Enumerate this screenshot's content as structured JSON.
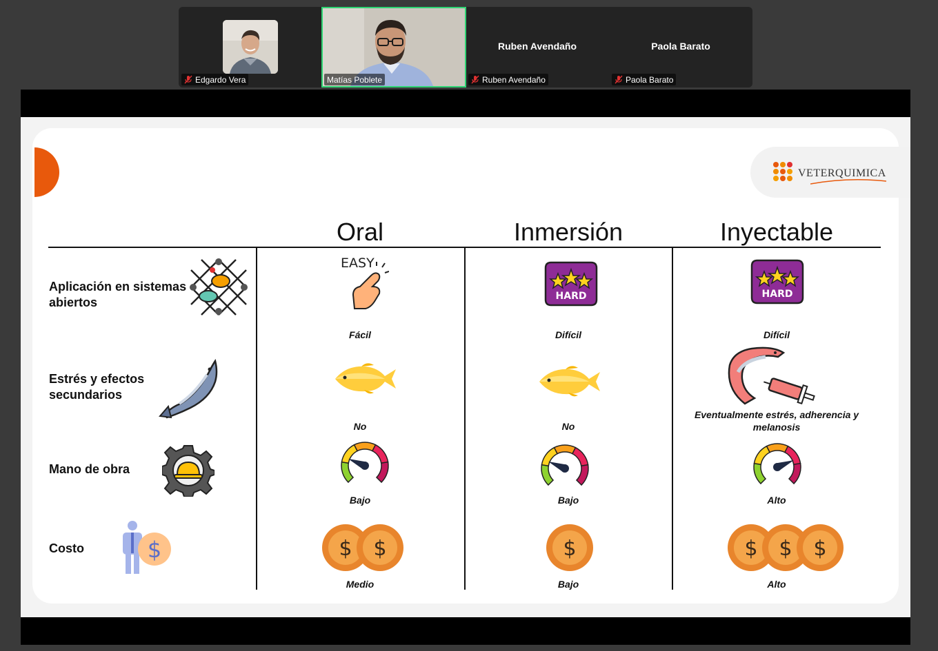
{
  "participants": [
    {
      "name": "Edgardo Vera",
      "muted": true
    },
    {
      "name": "Matías Poblete",
      "muted": false,
      "active": true
    },
    {
      "name": "Ruben Avendaño",
      "muted": true,
      "display_name": "Ruben Avendaño"
    },
    {
      "name": "Paola Barato",
      "muted": true,
      "display_name": "Paola Barato"
    }
  ],
  "slide": {
    "logo": "VETERQUIMICA",
    "columns": [
      "Oral",
      "Inmersión",
      "Inyectable"
    ],
    "rows": [
      {
        "label_line1": "Aplicación en sistemas",
        "label_line2": "abiertos",
        "icon": "fish-net-icon",
        "cells": [
          {
            "icon": "easy-icon",
            "badge": "EASY",
            "text": "Fácil"
          },
          {
            "icon": "hard-badge-icon",
            "badge": "HARD",
            "text": "Difícil"
          },
          {
            "icon": "hard-badge-icon",
            "badge": "HARD",
            "text": "Difícil"
          }
        ]
      },
      {
        "label_line1": "Estrés y efectos",
        "label_line2": "secundarios",
        "icon": "fish-icon",
        "cells": [
          {
            "icon": "yellow-fish-icon",
            "text": "No"
          },
          {
            "icon": "yellow-fish-icon",
            "text": "No"
          },
          {
            "icon": "salmon-syringe-icon",
            "text_line1": "Eventualmente estrés, adherencia y",
            "text_line2": "melanosis"
          }
        ]
      },
      {
        "label_line1": "Mano de obra",
        "icon": "gear-helmet-icon",
        "cells": [
          {
            "icon": "gauge-icon",
            "level": 0.25,
            "text": "Bajo"
          },
          {
            "icon": "gauge-icon",
            "level": 0.25,
            "text": "Bajo"
          },
          {
            "icon": "gauge-icon",
            "level": 0.75,
            "text": "Alto"
          }
        ]
      },
      {
        "label_line1": "Costo",
        "icon": "person-money-icon",
        "cells": [
          {
            "icon": "coins-icon",
            "coins": 2,
            "coin_symbol": "$",
            "text": "Medio"
          },
          {
            "icon": "coins-icon",
            "coins": 1,
            "coin_symbol": "$",
            "text": "Bajo"
          },
          {
            "icon": "coins-icon",
            "coins": 3,
            "coin_symbol": "$",
            "text": "Alto"
          }
        ]
      }
    ]
  },
  "colors": {
    "accent": "#e8590c",
    "active_border": "#2ed573",
    "hard_purple": "#8e2c96",
    "star": "#ffd21f"
  }
}
